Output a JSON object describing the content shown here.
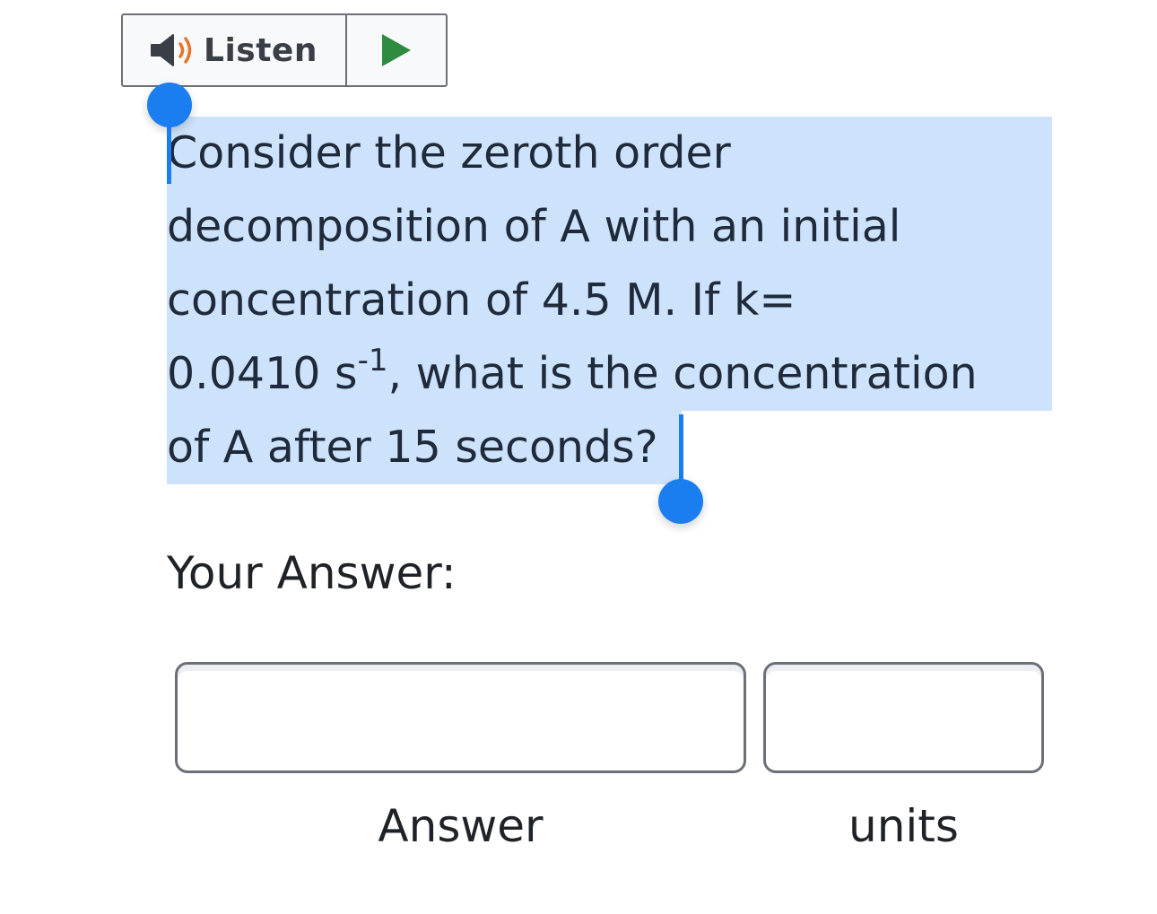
{
  "toolbar": {
    "listen_label": "Listen",
    "speaker_icon": "speaker-icon",
    "play_icon": "play-icon",
    "colors": {
      "speaker": "#3a3f47",
      "sound_waves": "#e8742a",
      "play": "#2e8b3f"
    }
  },
  "question": {
    "line1": "Consider the zeroth order",
    "line2": "decomposition of A with an initial",
    "line3": "concentration of 4.5 M. If k=",
    "line4_before": "0.0410 s",
    "line4_exponent": "-1",
    "line4_after": ", what is the concentration",
    "line5": "of A after 15 seconds?",
    "selected": true,
    "highlight_color": "#cde3fb",
    "handle_color": "#1a7df0"
  },
  "answer_section": {
    "heading": "Your Answer:",
    "answer_field": {
      "value": "",
      "label": "Answer"
    },
    "units_field": {
      "value": "",
      "label": "units"
    }
  }
}
